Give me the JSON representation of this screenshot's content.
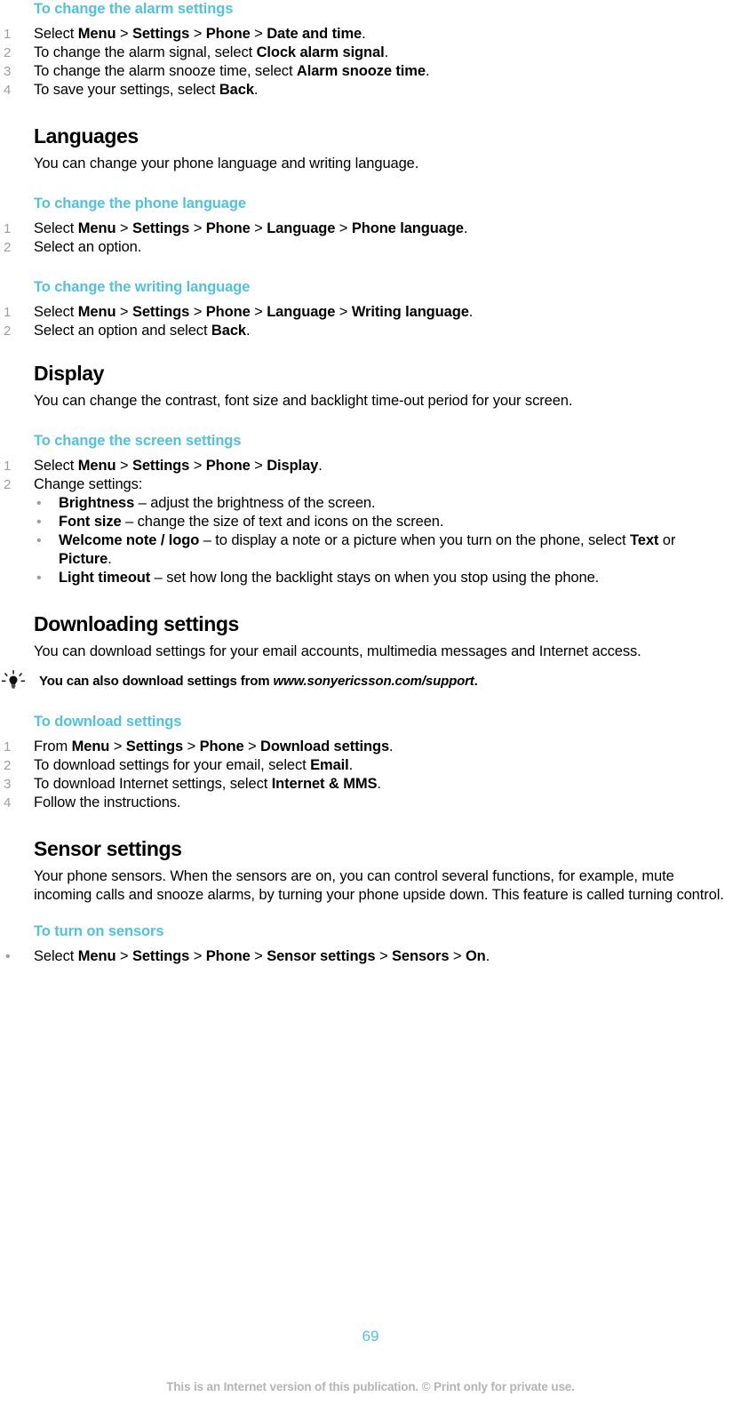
{
  "document": {
    "page_number": "69",
    "footer_note": "This is an Internet version of this publication. © Print only for private use.",
    "accent_color": "#4fc2e0",
    "muted_color": "#9d9d9d"
  },
  "sections": [
    {
      "id": "alarm-settings",
      "procedure_heading": "To change the alarm settings",
      "steps": [
        {
          "num": "1",
          "parts": [
            {
              "t": "Select "
            },
            {
              "b": "Menu"
            },
            {
              "sep": " > "
            },
            {
              "b": "Settings"
            },
            {
              "sep": " > "
            },
            {
              "b": "Phone"
            },
            {
              "sep": " > "
            },
            {
              "b": "Date and time"
            },
            {
              "t": "."
            }
          ]
        },
        {
          "num": "2",
          "parts": [
            {
              "t": "To change the alarm signal, select "
            },
            {
              "b": "Clock alarm signal"
            },
            {
              "t": "."
            }
          ]
        },
        {
          "num": "3",
          "parts": [
            {
              "t": "To change the alarm snooze time, select "
            },
            {
              "b": "Alarm snooze time"
            },
            {
              "t": "."
            }
          ]
        },
        {
          "num": "4",
          "parts": [
            {
              "t": "To save your settings, select "
            },
            {
              "b": "Back"
            },
            {
              "t": "."
            }
          ]
        }
      ]
    },
    {
      "id": "languages",
      "section_heading": "Languages",
      "intro": "You can change your phone language and writing language.",
      "procedures": [
        {
          "heading": "To change the phone language",
          "steps": [
            {
              "num": "1",
              "parts": [
                {
                  "t": "Select "
                },
                {
                  "b": "Menu"
                },
                {
                  "sep": " > "
                },
                {
                  "b": "Settings"
                },
                {
                  "sep": " > "
                },
                {
                  "b": "Phone"
                },
                {
                  "sep": " > "
                },
                {
                  "b": "Language"
                },
                {
                  "sep": " > "
                },
                {
                  "b": "Phone language"
                },
                {
                  "t": "."
                }
              ]
            },
            {
              "num": "2",
              "parts": [
                {
                  "t": "Select an option."
                }
              ]
            }
          ]
        },
        {
          "heading": "To change the writing language",
          "steps": [
            {
              "num": "1",
              "parts": [
                {
                  "t": "Select "
                },
                {
                  "b": "Menu"
                },
                {
                  "sep": " > "
                },
                {
                  "b": "Settings"
                },
                {
                  "sep": " > "
                },
                {
                  "b": "Phone"
                },
                {
                  "sep": " > "
                },
                {
                  "b": "Language"
                },
                {
                  "sep": " > "
                },
                {
                  "b": "Writing language"
                },
                {
                  "t": "."
                }
              ]
            },
            {
              "num": "2",
              "parts": [
                {
                  "t": "Select an option and select "
                },
                {
                  "b": "Back"
                },
                {
                  "t": "."
                }
              ]
            }
          ]
        }
      ]
    },
    {
      "id": "display",
      "section_heading": "Display",
      "intro": "You can change the contrast, font size and backlight time-out period for your screen.",
      "procedures": [
        {
          "heading": "To change the screen settings",
          "steps": [
            {
              "num": "1",
              "parts": [
                {
                  "t": "Select "
                },
                {
                  "b": "Menu"
                },
                {
                  "sep": " > "
                },
                {
                  "b": "Settings"
                },
                {
                  "sep": " > "
                },
                {
                  "b": "Phone"
                },
                {
                  "sep": " > "
                },
                {
                  "b": "Display"
                },
                {
                  "t": "."
                }
              ]
            },
            {
              "num": "2",
              "parts": [
                {
                  "t": "Change settings:"
                }
              ],
              "sub_bullets": [
                {
                  "parts": [
                    {
                      "b": "Brightness"
                    },
                    {
                      "t": " – adjust the brightness of the screen."
                    }
                  ]
                },
                {
                  "parts": [
                    {
                      "b": "Font size"
                    },
                    {
                      "t": " – change the size of text and icons on the screen."
                    }
                  ]
                },
                {
                  "condensed": true,
                  "parts": [
                    {
                      "b": "Welcome note / logo"
                    },
                    {
                      "t": " – to display a note or a picture when you turn on the phone, select "
                    },
                    {
                      "b": "Text"
                    },
                    {
                      "t": " or "
                    },
                    {
                      "b": "Picture"
                    },
                    {
                      "t": "."
                    }
                  ]
                },
                {
                  "parts": [
                    {
                      "b": "Light timeout"
                    },
                    {
                      "t": " – set how long the backlight stays on when you stop using the phone."
                    }
                  ]
                }
              ]
            }
          ]
        }
      ]
    },
    {
      "id": "downloading-settings",
      "section_heading": "Downloading settings",
      "intro": "You can download settings for your email accounts, multimedia messages and Internet access.",
      "tip": {
        "icon": "lightbulb-icon",
        "text_before": "You can also download settings from ",
        "url": "www.sonyericsson.com/support",
        "text_after": "."
      },
      "procedures": [
        {
          "heading": "To download settings",
          "steps": [
            {
              "num": "1",
              "parts": [
                {
                  "t": "From "
                },
                {
                  "b": "Menu"
                },
                {
                  "sep": " > "
                },
                {
                  "b": "Settings"
                },
                {
                  "sep": " > "
                },
                {
                  "b": "Phone"
                },
                {
                  "sep": " > "
                },
                {
                  "b": "Download settings"
                },
                {
                  "t": "."
                }
              ]
            },
            {
              "num": "2",
              "parts": [
                {
                  "t": "To download settings for your email, select "
                },
                {
                  "b": "Email"
                },
                {
                  "t": "."
                }
              ]
            },
            {
              "num": "3",
              "parts": [
                {
                  "t": "To download Internet settings, select "
                },
                {
                  "b": "Internet & MMS"
                },
                {
                  "t": "."
                }
              ]
            },
            {
              "num": "4",
              "parts": [
                {
                  "t": "Follow the instructions."
                }
              ]
            }
          ]
        }
      ]
    },
    {
      "id": "sensor-settings",
      "section_heading": "Sensor settings",
      "intro": "Your phone sensors. When the sensors are on, you can control several functions, for example, mute incoming calls and snooze alarms, by turning your phone upside down. This feature is called turning control.",
      "procedures": [
        {
          "heading": "To turn on sensors",
          "bullets": [
            {
              "parts": [
                {
                  "t": "Select "
                },
                {
                  "b": "Menu"
                },
                {
                  "sep": " > "
                },
                {
                  "b": "Settings"
                },
                {
                  "sep": " > "
                },
                {
                  "b": "Phone"
                },
                {
                  "sep": " > "
                },
                {
                  "b": "Sensor settings"
                },
                {
                  "sep": " > "
                },
                {
                  "b": "Sensors"
                },
                {
                  "sep": " > "
                },
                {
                  "b": "On"
                },
                {
                  "t": "."
                }
              ]
            }
          ]
        }
      ]
    }
  ]
}
